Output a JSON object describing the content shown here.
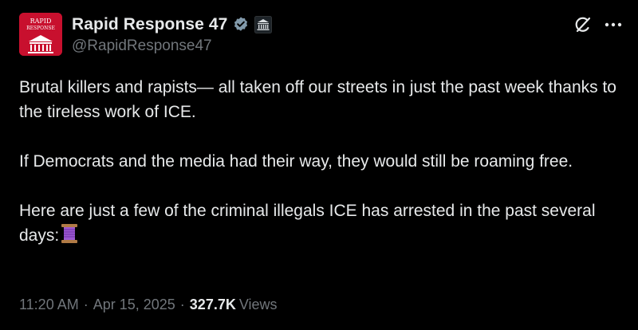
{
  "header": {
    "display_name": "Rapid Response 47",
    "handle": "@RapidResponse47",
    "avatar_text_top": "RAPID",
    "avatar_text_bottom": "RESPONSE"
  },
  "icons": {
    "verified": "verified-badge-icon",
    "government": "government-building-icon",
    "grok": "grok-icon",
    "more": "more-options-icon",
    "spool": "spool-of-thread-emoji"
  },
  "colors": {
    "background": "#000000",
    "text_primary": "#e7e9ea",
    "text_secondary": "#71767b",
    "verified_badge": "#829aab",
    "avatar_bg": "#c8102e"
  },
  "tweet": {
    "paragraphs": [
      "Brutal killers and rapists— all taken off our streets in just the past week thanks to the tireless work of ICE.",
      "If Democrats and the media had their way, they would still be roaming free.",
      "Here are just a few of the criminal illegals ICE has arrested in the past several days:"
    ]
  },
  "meta": {
    "time": "11:20 AM",
    "separator": "·",
    "date": "Apr 15, 2025",
    "views_count": "327.7K",
    "views_label": "Views"
  }
}
